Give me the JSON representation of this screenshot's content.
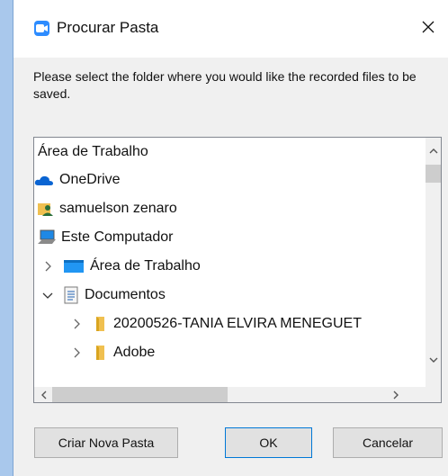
{
  "window": {
    "title": "Procurar Pasta",
    "prompt": "Please select the folder where you would like the recorded files to be saved."
  },
  "tree": {
    "items": [
      {
        "label": "Área de Trabalho",
        "icon": "none"
      },
      {
        "label": "OneDrive",
        "icon": "cloud-icon"
      },
      {
        "label": "samuelson zenaro",
        "icon": "user-folder-icon"
      },
      {
        "label": "Este Computador",
        "icon": "computer-icon"
      },
      {
        "label": "Área de Trabalho",
        "icon": "desktop-folder-icon",
        "expander": "collapsed"
      },
      {
        "label": "Documentos",
        "icon": "documents-icon",
        "expander": "expanded"
      },
      {
        "label": "20200526-TANIA ELVIRA MENEGUET",
        "icon": "folder-icon",
        "expander": "collapsed"
      },
      {
        "label": "Adobe",
        "icon": "folder-icon",
        "expander": "collapsed"
      }
    ]
  },
  "buttons": {
    "new_folder": "Criar Nova Pasta",
    "ok": "OK",
    "cancel": "Cancelar"
  },
  "colors": {
    "accent": "#2d8cff",
    "default_button_border": "#0078d7",
    "folder": "#f0c050"
  }
}
